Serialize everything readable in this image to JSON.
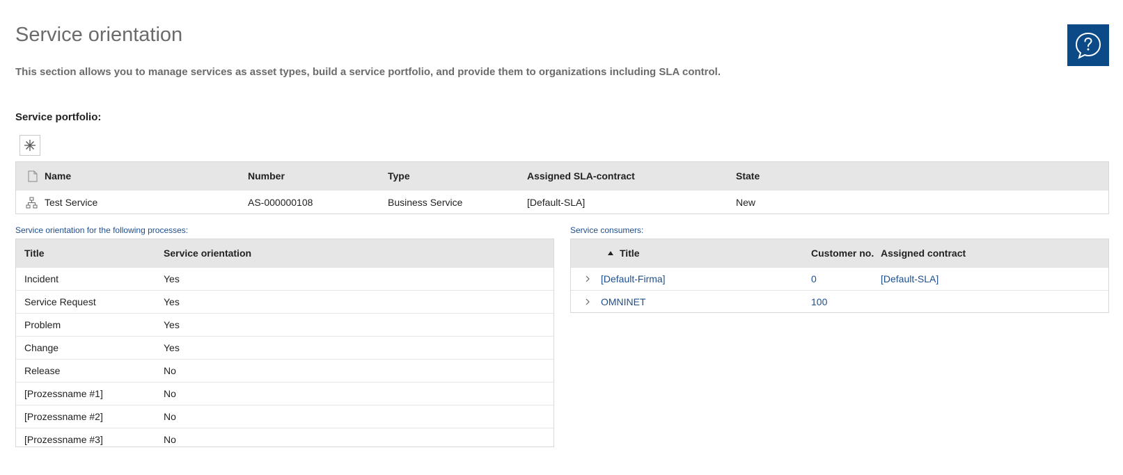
{
  "page": {
    "title": "Service orientation",
    "description": "This section allows you to manage services as asset types, build a service portfolio, and provide them to organizations including SLA control.",
    "help_icon": "help-speech-bubble-icon"
  },
  "portfolio": {
    "section_title": "Service portfolio:",
    "new_icon": "asterisk-icon",
    "columns": [
      "Name",
      "Number",
      "Type",
      "Assigned SLA-contract",
      "State"
    ],
    "rows": [
      {
        "icon": "service-hierarchy-icon",
        "name": "Test Service",
        "number": "AS-000000108",
        "type": "Business Service",
        "sla": "[Default-SLA]",
        "state": "New"
      }
    ]
  },
  "processes": {
    "caption": "Service orientation for the following processes:",
    "columns": [
      "Title",
      "Service orientation"
    ],
    "rows": [
      {
        "title": "Incident",
        "value": "Yes"
      },
      {
        "title": "Service Request",
        "value": "Yes"
      },
      {
        "title": "Problem",
        "value": "Yes"
      },
      {
        "title": "Change",
        "value": "Yes"
      },
      {
        "title": "Release",
        "value": "No"
      },
      {
        "title": "[Prozessname #1]",
        "value": "No"
      },
      {
        "title": "[Prozessname #2]",
        "value": "No"
      },
      {
        "title": "[Prozessname #3]",
        "value": "No"
      }
    ]
  },
  "consumers": {
    "caption": "Service consumers:",
    "columns": [
      "Title",
      "Customer no.",
      "Assigned contract"
    ],
    "sort": "ascending",
    "rows": [
      {
        "title": "[Default-Firma]",
        "customer_no": "0",
        "contract": "[Default-SLA]"
      },
      {
        "title": "OMNINET",
        "customer_no": "100",
        "contract": ""
      }
    ]
  },
  "colors": {
    "accent": "#0b4a86",
    "link": "#1e4f8c",
    "header_bg": "#e6e6e6"
  }
}
